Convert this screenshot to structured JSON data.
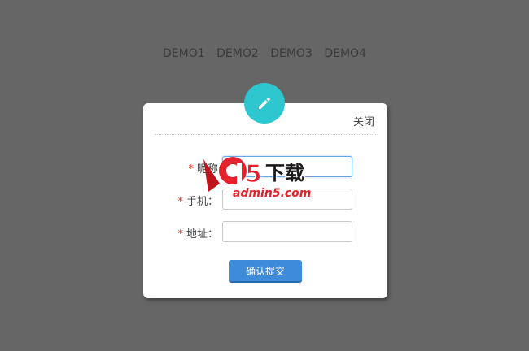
{
  "nav": {
    "items": [
      "DEMO1",
      "DEMO2",
      "DEMO3",
      "DEMO4"
    ]
  },
  "dialog": {
    "icon": "pencil-icon",
    "close_label": "关闭",
    "fields": [
      {
        "required": "*",
        "label": "昵称",
        "value": ""
      },
      {
        "required": "*",
        "label": "手机：",
        "value": ""
      },
      {
        "required": "*",
        "label": "地址：",
        "value": ""
      }
    ],
    "submit_label": "确认提交"
  },
  "watermark": {
    "brand": "a5",
    "title": "下载",
    "url": "admin5.com"
  },
  "colors": {
    "backdrop": "#666666",
    "accent": "#2ec6cf",
    "button": "#3d8bd9",
    "required": "#e0281b"
  }
}
